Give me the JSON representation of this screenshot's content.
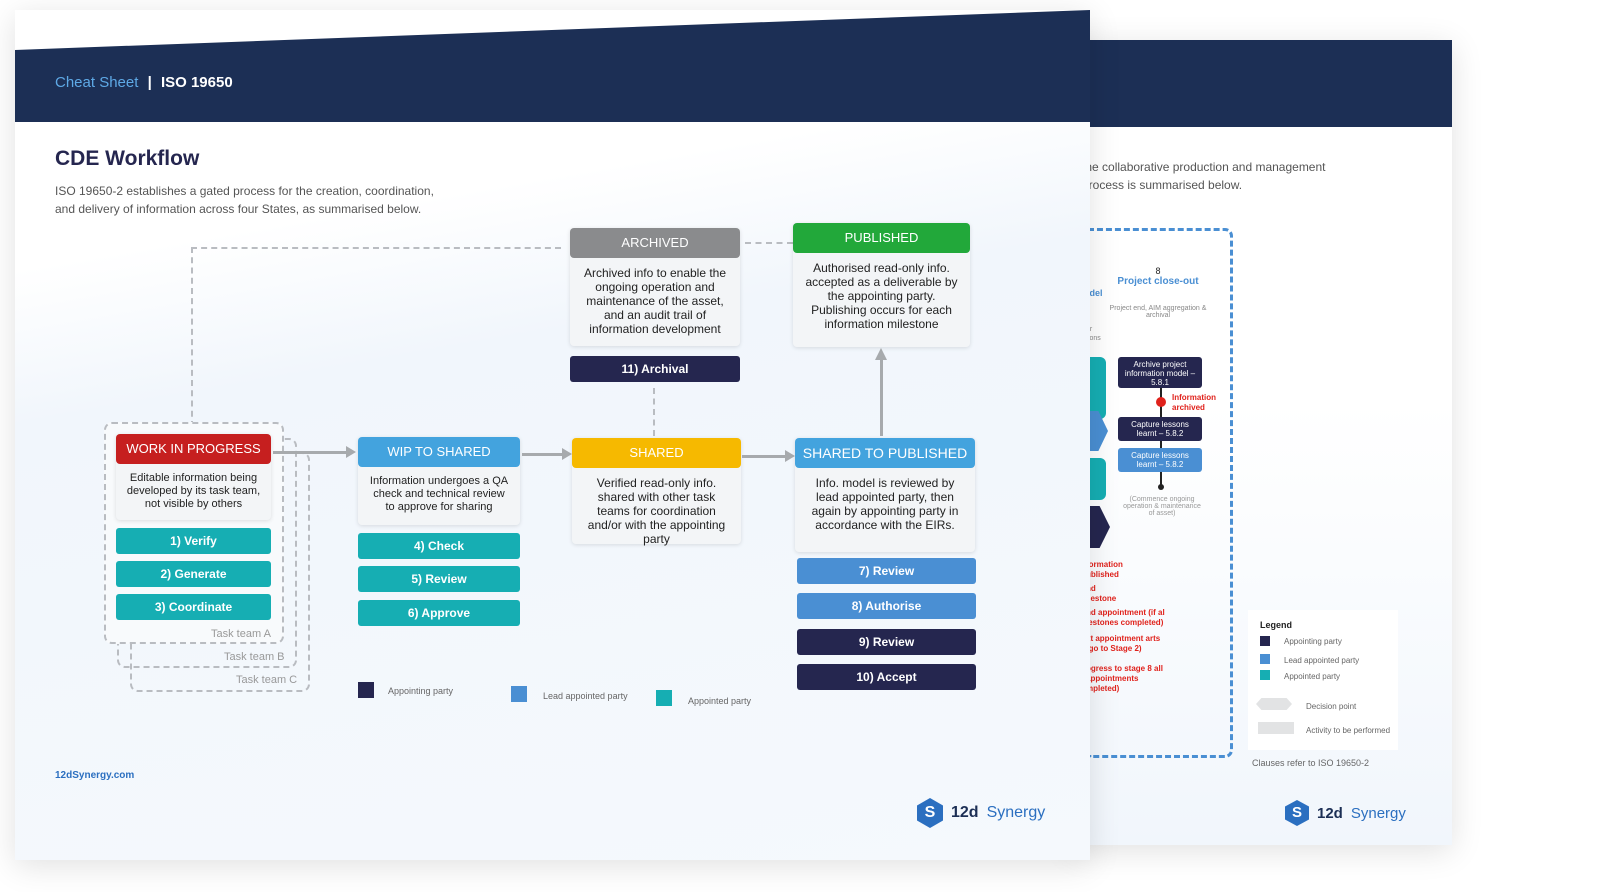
{
  "back_page": {
    "intro": "the collaborative production and management process is summarised below.",
    "stage": {
      "number": "8",
      "title": "Project close-out",
      "desc": "Project end, AIM aggregation & archival"
    },
    "left_fragments": [
      "odel",
      "for",
      "stons"
    ],
    "activities": [
      {
        "text": "Archive project information model – 5.8.1",
        "party": "appointing"
      },
      {
        "text": "Capture lessons learnt – 5.8.2",
        "party": "appointing"
      },
      {
        "text": "Capture lessons learnt – 5.8.2",
        "party": "lead"
      }
    ],
    "milestone": "Information archived",
    "end_note": "(Commence ongoing operation & maintenance of asset)",
    "red_notes": [
      "formation ublished",
      "nd ilestone",
      "nd appointment (if al lestones completed)",
      "xt appointment arts (go to Stage 2)",
      "ogress to stage 8 all appointments mpleted)"
    ],
    "legend": {
      "title": "Legend",
      "items": [
        "Appointing party",
        "Lead appointed party",
        "Appointed party",
        "Decision point",
        "Activity to be performed"
      ]
    },
    "footnote": "Clauses refer to ISO 19650-2",
    "logo": {
      "brand": "12d",
      "name": "Synergy"
    }
  },
  "front_page": {
    "header": {
      "section": "Cheat Sheet",
      "separator": "|",
      "title": "ISO 19650"
    },
    "title": "CDE Workflow",
    "intro": "ISO 19650-2 establishes a gated process for the creation, coordination, and delivery of information across four States, as summarised below.",
    "states": {
      "wip": {
        "title": "WORK IN PROGRESS",
        "desc": "Editable information being developed by its task team, not visible by others",
        "color": "#c61f1f"
      },
      "wip_to_shared": {
        "title": "WIP TO SHARED",
        "desc": "Information undergoes a QA check and technical review to approve for sharing",
        "color": "#43a3de"
      },
      "shared": {
        "title": "SHARED",
        "desc": "Verified read-only info. shared with other task teams for coordination and/or with the appointing party",
        "color": "#f6b900"
      },
      "shared_to_published": {
        "title": "SHARED TO PUBLISHED",
        "desc": "Info. model is reviewed by lead appointed party, then again by appointing party in accordance with the EIRs.",
        "color": "#43a3de"
      },
      "archived": {
        "title": "ARCHIVED",
        "desc": "Archived info to enable the ongoing operation and maintenance of the asset, and an audit trail of information development",
        "color": "#8a8b8d"
      },
      "published": {
        "title": "PUBLISHED",
        "desc": "Authorised read-only info. accepted as a deliverable by the appointing party. Publishing occurs for each information milestone",
        "color": "#22a83a"
      }
    },
    "wip_actions": [
      "1) Verify",
      "2) Generate",
      "3) Coordinate"
    ],
    "task_teams": [
      "Task team A",
      "Task team B",
      "Task team C"
    ],
    "check_actions": [
      "4) Check",
      "5) Review",
      "6) Approve"
    ],
    "publish_actions": [
      {
        "label": "7) Review",
        "party": "lead"
      },
      {
        "label": "8) Authorise",
        "party": "lead"
      },
      {
        "label": "9) Review",
        "party": "appointing"
      },
      {
        "label": "10) Accept",
        "party": "appointing"
      }
    ],
    "archival_action": "11) Archival",
    "legend": [
      "Appointing party",
      "Lead appointed party",
      "Appointed party"
    ],
    "colors": {
      "appointing": "#25264f",
      "lead": "#4a8fd3",
      "appointed": "#16aeb3",
      "banner": "#1c2f55"
    },
    "website": "12dSynergy.com",
    "logo": {
      "brand": "12d",
      "name": "Synergy"
    }
  }
}
